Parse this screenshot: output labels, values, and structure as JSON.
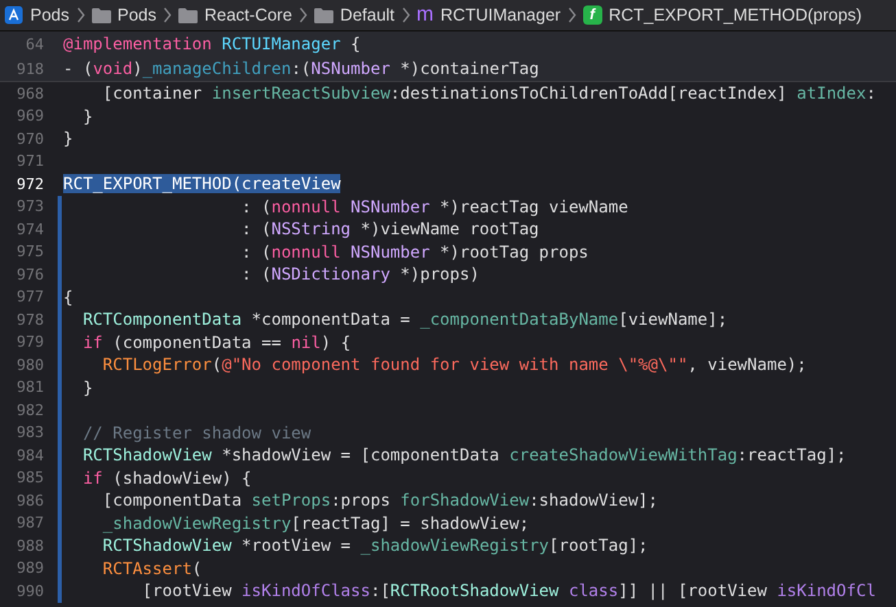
{
  "breadcrumb": [
    {
      "kind": "project",
      "label": "Pods"
    },
    {
      "kind": "folder",
      "label": "Pods"
    },
    {
      "kind": "folder",
      "label": "React-Core"
    },
    {
      "kind": "folder",
      "label": "Default"
    },
    {
      "kind": "m",
      "glyph": "m",
      "label": "RCTUIManager"
    },
    {
      "kind": "f",
      "glyph": "f",
      "label": "RCT_EXPORT_METHOD(props)"
    }
  ],
  "sticky_header": [
    {
      "number": "64",
      "tokens": [
        {
          "kind": "kw",
          "text": "@implementation "
        },
        {
          "kind": "decl",
          "text": "RCTUIManager"
        },
        {
          "kind": "plain",
          "text": " {"
        }
      ]
    },
    {
      "number": "918",
      "tokens": [
        {
          "kind": "plain",
          "text": "- ("
        },
        {
          "kind": "kw",
          "text": "void"
        },
        {
          "kind": "plain",
          "text": ")"
        },
        {
          "kind": "decl2",
          "text": "_manageChildren"
        },
        {
          "kind": "plain",
          "text": ":("
        },
        {
          "kind": "type",
          "text": "NSNumber"
        },
        {
          "kind": "plain",
          "text": " *)containerTag"
        }
      ]
    }
  ],
  "lines": [
    {
      "number": "968",
      "current": false,
      "in_scope": false,
      "tokens": [
        {
          "kind": "plain",
          "text": "    [container "
        },
        {
          "kind": "fn",
          "text": "insertReactSubview"
        },
        {
          "kind": "plain",
          "text": ":destinationsToChildrenToAdd[reactIndex] "
        },
        {
          "kind": "fn",
          "text": "atIndex"
        },
        {
          "kind": "plain",
          "text": ":"
        }
      ]
    },
    {
      "number": "969",
      "current": false,
      "in_scope": false,
      "tokens": [
        {
          "kind": "plain",
          "text": "  }"
        }
      ]
    },
    {
      "number": "970",
      "current": false,
      "in_scope": false,
      "tokens": [
        {
          "kind": "plain",
          "text": "}"
        }
      ]
    },
    {
      "number": "971",
      "current": false,
      "in_scope": false
    },
    {
      "number": "972",
      "current": true,
      "in_scope": false,
      "tokens": [
        {
          "kind": "selection",
          "text": "RCT_EXPORT_METHOD(createView"
        }
      ]
    },
    {
      "number": "973",
      "current": false,
      "in_scope": true,
      "tokens": [
        {
          "kind": "plain",
          "text": "                  : ("
        },
        {
          "kind": "kw",
          "text": "nonnull "
        },
        {
          "kind": "type",
          "text": "NSNumber"
        },
        {
          "kind": "plain",
          "text": " *)reactTag viewName"
        }
      ]
    },
    {
      "number": "974",
      "current": false,
      "in_scope": true,
      "tokens": [
        {
          "kind": "plain",
          "text": "                  : ("
        },
        {
          "kind": "type",
          "text": "NSString"
        },
        {
          "kind": "plain",
          "text": " *)viewName rootTag"
        }
      ]
    },
    {
      "number": "975",
      "current": false,
      "in_scope": true,
      "tokens": [
        {
          "kind": "plain",
          "text": "                  : ("
        },
        {
          "kind": "kw",
          "text": "nonnull "
        },
        {
          "kind": "type",
          "text": "NSNumber"
        },
        {
          "kind": "plain",
          "text": " *)rootTag props"
        }
      ]
    },
    {
      "number": "976",
      "current": false,
      "in_scope": true,
      "tokens": [
        {
          "kind": "plain",
          "text": "                  : ("
        },
        {
          "kind": "type",
          "text": "NSDictionary"
        },
        {
          "kind": "plain",
          "text": " *)props)"
        }
      ]
    },
    {
      "number": "977",
      "current": false,
      "in_scope": true,
      "tokens": [
        {
          "kind": "plain",
          "text": "{"
        }
      ]
    },
    {
      "number": "978",
      "current": false,
      "in_scope": true,
      "tokens": [
        {
          "kind": "cls",
          "text": "  RCTComponentData"
        },
        {
          "kind": "plain",
          "text": " *componentData = "
        },
        {
          "kind": "fn",
          "text": "_componentDataByName"
        },
        {
          "kind": "plain",
          "text": "[viewName];"
        }
      ]
    },
    {
      "number": "979",
      "current": false,
      "in_scope": true,
      "tokens": [
        {
          "kind": "kw",
          "text": "  if"
        },
        {
          "kind": "plain",
          "text": " (componentData == "
        },
        {
          "kind": "kw",
          "text": "nil"
        },
        {
          "kind": "plain",
          "text": ") {"
        }
      ]
    },
    {
      "number": "980",
      "current": false,
      "in_scope": true,
      "tokens": [
        {
          "kind": "macro",
          "text": "    RCTLogError"
        },
        {
          "kind": "plain",
          "text": "("
        },
        {
          "kind": "str",
          "text": "@\"No component found for view with name \\\"%@\\\"\""
        },
        {
          "kind": "plain",
          "text": ", viewName);"
        }
      ]
    },
    {
      "number": "981",
      "current": false,
      "in_scope": true,
      "tokens": [
        {
          "kind": "plain",
          "text": "  }"
        }
      ]
    },
    {
      "number": "982",
      "current": false,
      "in_scope": true
    },
    {
      "number": "983",
      "current": false,
      "in_scope": true,
      "tokens": [
        {
          "kind": "comment",
          "text": "  // Register shadow view"
        }
      ]
    },
    {
      "number": "984",
      "current": false,
      "in_scope": true,
      "tokens": [
        {
          "kind": "cls",
          "text": "  RCTShadowView"
        },
        {
          "kind": "plain",
          "text": " *shadowView = [componentData "
        },
        {
          "kind": "fn",
          "text": "createShadowViewWithTag"
        },
        {
          "kind": "plain",
          "text": ":reactTag];"
        }
      ]
    },
    {
      "number": "985",
      "current": false,
      "in_scope": true,
      "tokens": [
        {
          "kind": "kw",
          "text": "  if"
        },
        {
          "kind": "plain",
          "text": " (shadowView) {"
        }
      ]
    },
    {
      "number": "986",
      "current": false,
      "in_scope": true,
      "tokens": [
        {
          "kind": "plain",
          "text": "    [componentData "
        },
        {
          "kind": "fn",
          "text": "setProps"
        },
        {
          "kind": "plain",
          "text": ":props "
        },
        {
          "kind": "fn",
          "text": "forShadowView"
        },
        {
          "kind": "plain",
          "text": ":shadowView];"
        }
      ]
    },
    {
      "number": "987",
      "current": false,
      "in_scope": true,
      "tokens": [
        {
          "kind": "fn",
          "text": "    _shadowViewRegistry"
        },
        {
          "kind": "plain",
          "text": "[reactTag] = shadowView;"
        }
      ]
    },
    {
      "number": "988",
      "current": false,
      "in_scope": true,
      "tokens": [
        {
          "kind": "cls",
          "text": "    RCTShadowView"
        },
        {
          "kind": "plain",
          "text": " *rootView = "
        },
        {
          "kind": "fn",
          "text": "_shadowViewRegistry"
        },
        {
          "kind": "plain",
          "text": "[rootTag];"
        }
      ]
    },
    {
      "number": "989",
      "current": false,
      "in_scope": true,
      "tokens": [
        {
          "kind": "macro",
          "text": "    RCTAssert"
        },
        {
          "kind": "plain",
          "text": "("
        }
      ]
    },
    {
      "number": "990",
      "current": false,
      "in_scope": true,
      "tokens": [
        {
          "kind": "plain",
          "text": "        [rootView "
        },
        {
          "kind": "sysfn",
          "text": "isKindOfClass"
        },
        {
          "kind": "plain",
          "text": ":["
        },
        {
          "kind": "cls",
          "text": "RCTRootShadowView "
        },
        {
          "kind": "sysfn",
          "text": "class"
        },
        {
          "kind": "plain",
          "text": "]] || [rootView "
        },
        {
          "kind": "sysfn",
          "text": "isKindOfCl"
        }
      ]
    }
  ]
}
